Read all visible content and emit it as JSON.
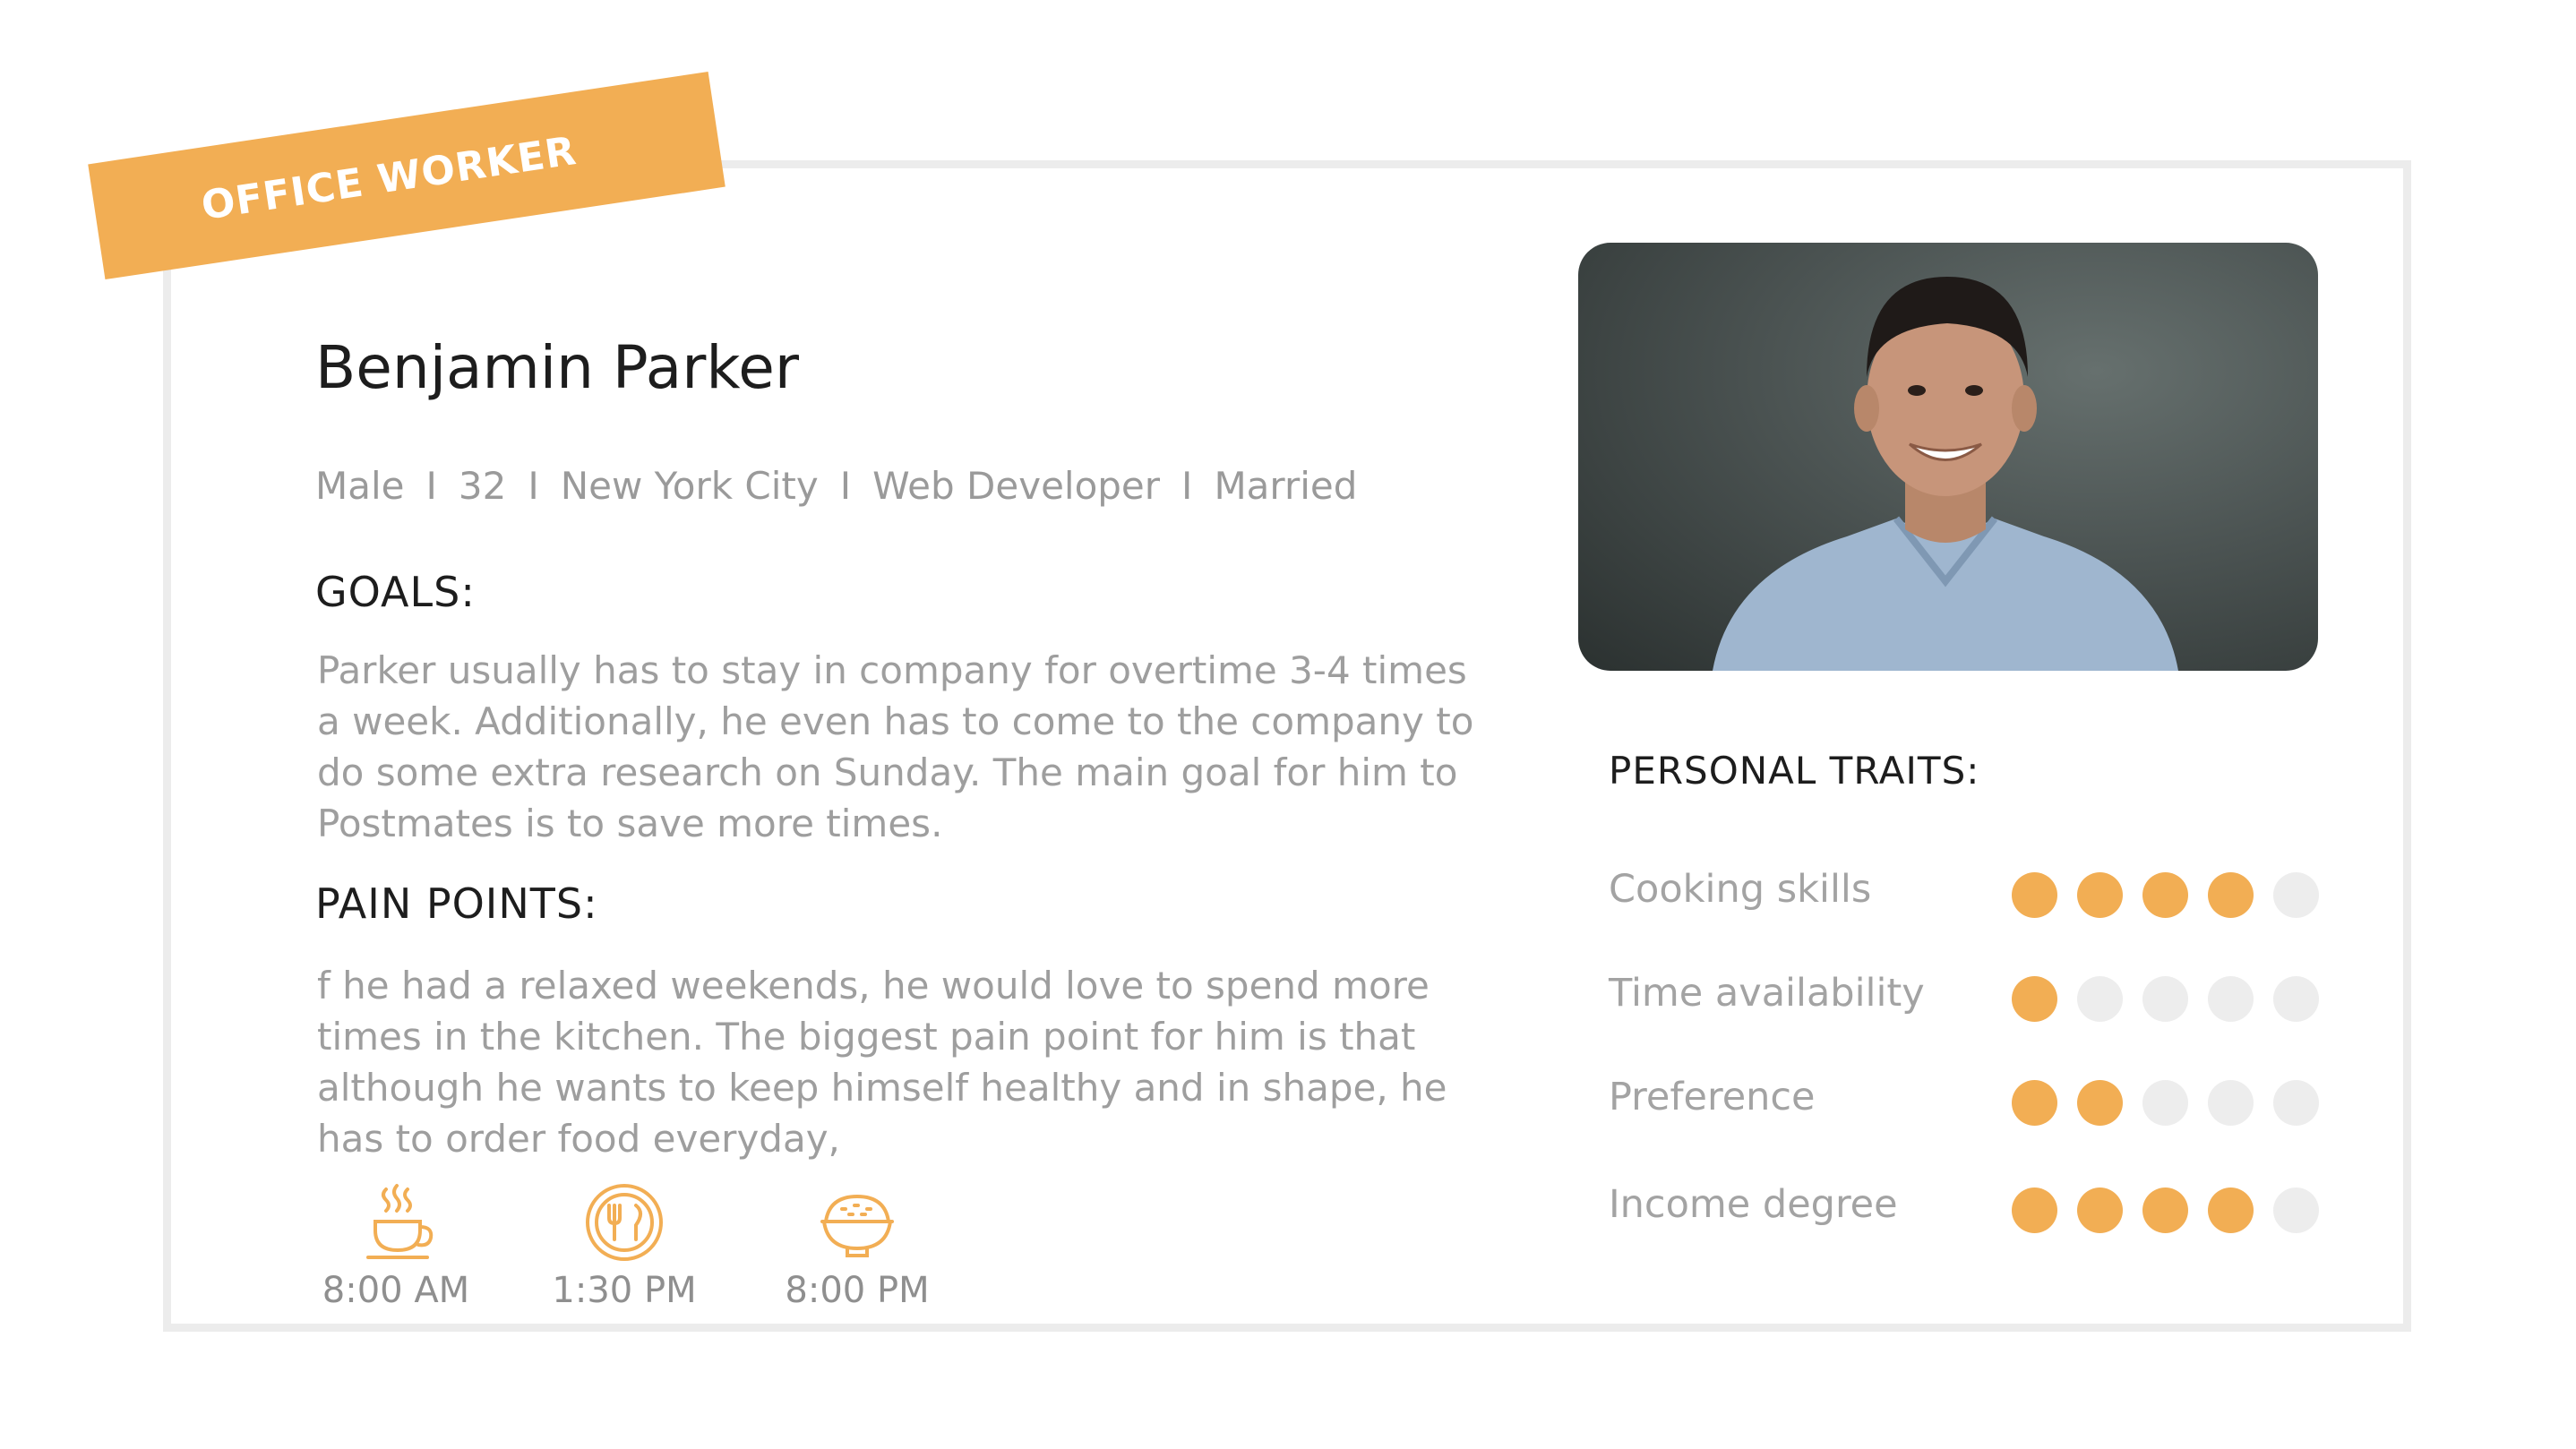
{
  "ribbon": {
    "label": "OFFICE WORKER"
  },
  "persona": {
    "name": "Benjamin Parker",
    "meta": [
      "Male",
      "32",
      "New York City",
      "Web Developer",
      "Married"
    ],
    "separator": "I"
  },
  "goals": {
    "heading": "GOALS:",
    "text": "Parker usually has to stay in company for overtime 3-4 times a week. Additionally, he even has to come to the company to do some extra research on Sunday. The main goal for him to Postmates is to save more times."
  },
  "pain_points": {
    "heading": "PAIN POINTS:",
    "text": "f he had a relaxed weekends, he would love to spend more times in the kitchen. The biggest pain point for him is that although he wants to keep himself healthy and in shape, he has to order food everyday,"
  },
  "meals": [
    {
      "icon": "coffee-cup-icon",
      "time": "8:00 AM"
    },
    {
      "icon": "plate-cutlery-icon",
      "time": "1:30 PM"
    },
    {
      "icon": "rice-bowl-icon",
      "time": "8:00 PM"
    }
  ],
  "traits": {
    "heading": "PERSONAL TRAITS:",
    "scale_max": 5,
    "items": [
      {
        "label": "Cooking skills",
        "level": 4
      },
      {
        "label": "Time availability",
        "level": 1
      },
      {
        "label": "Preference",
        "level": 2
      },
      {
        "label": "Income degree",
        "level": 4
      }
    ]
  },
  "colors": {
    "accent": "#f2ae54",
    "inactive_dot": "#ededed",
    "muted_text": "#9e9e9e",
    "border": "#ececec"
  }
}
